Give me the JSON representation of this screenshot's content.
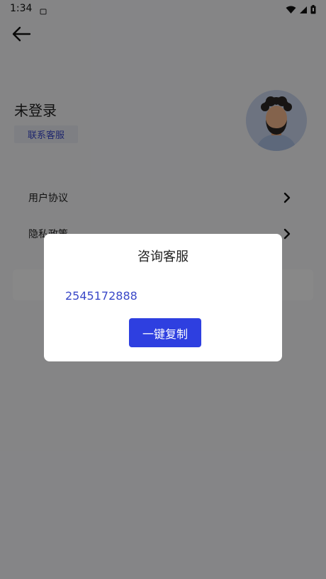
{
  "status_bar": {
    "time": "1:34",
    "icons": [
      "notification-icon",
      "wifi-icon",
      "signal-icon",
      "battery-icon"
    ]
  },
  "header": {
    "back_icon": "arrow-left-icon"
  },
  "profile": {
    "name": "未登录",
    "contact_label": "联系客服",
    "avatar_icon": "avatar-icon"
  },
  "menu": {
    "items": [
      {
        "label": "用户协议",
        "icon": "chevron-right-icon"
      },
      {
        "label": "隐私政策",
        "icon": "chevron-right-icon"
      }
    ]
  },
  "dialog": {
    "title": "咨询客服",
    "phone": "2545172888",
    "copy_label": "一键复制"
  },
  "colors": {
    "accent": "#2e3fe0",
    "link": "#3a48c8",
    "background": "#f2f3f5"
  }
}
